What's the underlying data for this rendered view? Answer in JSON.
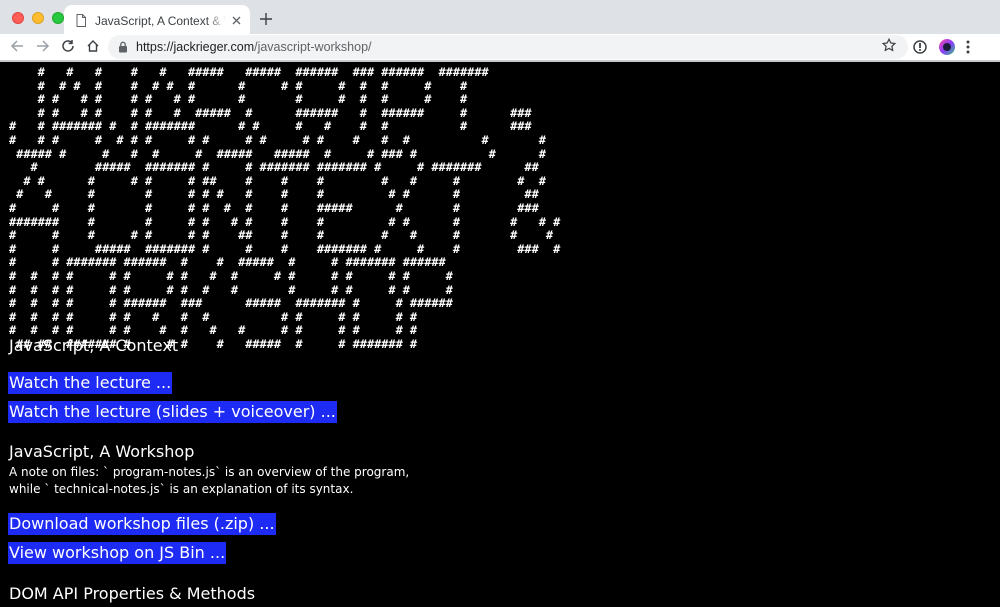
{
  "browser": {
    "tab_title": "JavaScript, A Context & Workshop",
    "url_host": "https://jackrieger.com",
    "url_path": "/javascript-workshop/"
  },
  "page": {
    "ascii_art": "    #   #   #    #   #   #####   #####  ######  ### ######  #######\n    #  # #  #    #  # #  #      #     # #     #  #  #     #    #\n    # #   # #    # #   # #      #       #     #  #  #     #    #\n    # #   # #    # #   #  #####  #      ######   #  ######     #      ###\n#   # ####### #  # #######      # #     #   #    #  #          #      ###\n#   # #     #  # # #     # #     # #     # #    #   #  #          #       #\n ##### #     #   #  #     #  #####   #####  #     # ### #          #      #\n   #        #####  ####### #     # ####### ####### #     # #######      ##\n  # #      #     # #     # ##    #    #    #        #   #     #        #  #\n #   #     #       #     # # #   #    #    #         # #      #         ##\n#     #    #       #     # #  #  #    #    #####      #       #        ###\n#######    #       #     # #   # #    #    #         # #      #       #   # #\n#     #    #     # #     # #    ##    #    #        #   #     #       #    #\n#     #     #####  ####### #     #    #    ####### #     #    #        ###  #\n#     # ####### ######  #    #  #####  #     # ####### ######\n#  #  # #     # #     # #   #  #     # #     # #     # #     #\n#  #  # #     # #     # #  #   #       #     # #     # #     #\n#  #  # #     # ######  ###      #####  ####### #     # ######\n#  #  # #     # #   #   #  #          # #     # #     # #\n#  #  # #     # #    #  #   #   #     # #     # #     # #\n ## ##  ####### #     # #    #   #####  #     # ####### #",
    "context_title": "JavaScript, A Context",
    "link_lecture": "Watch the lecture ...",
    "link_lecture_slides": "Watch the lecture (slides + voiceover) ...",
    "workshop_title": "JavaScript, A Workshop",
    "note_line1": "A note on files: ` program-notes.js`  is an overview of the program,",
    "note_line2": "while ` technical-notes.js`  is an explanation of its syntax.",
    "link_download": "Download workshop files (.zip) ...",
    "link_jsbin": "View workshop on JS Bin ...",
    "dom_title": "DOM API Properties & Methods"
  },
  "colors": {
    "link_background": "#1d2bf4",
    "page_background": "#000000",
    "text": "#ffffff"
  }
}
